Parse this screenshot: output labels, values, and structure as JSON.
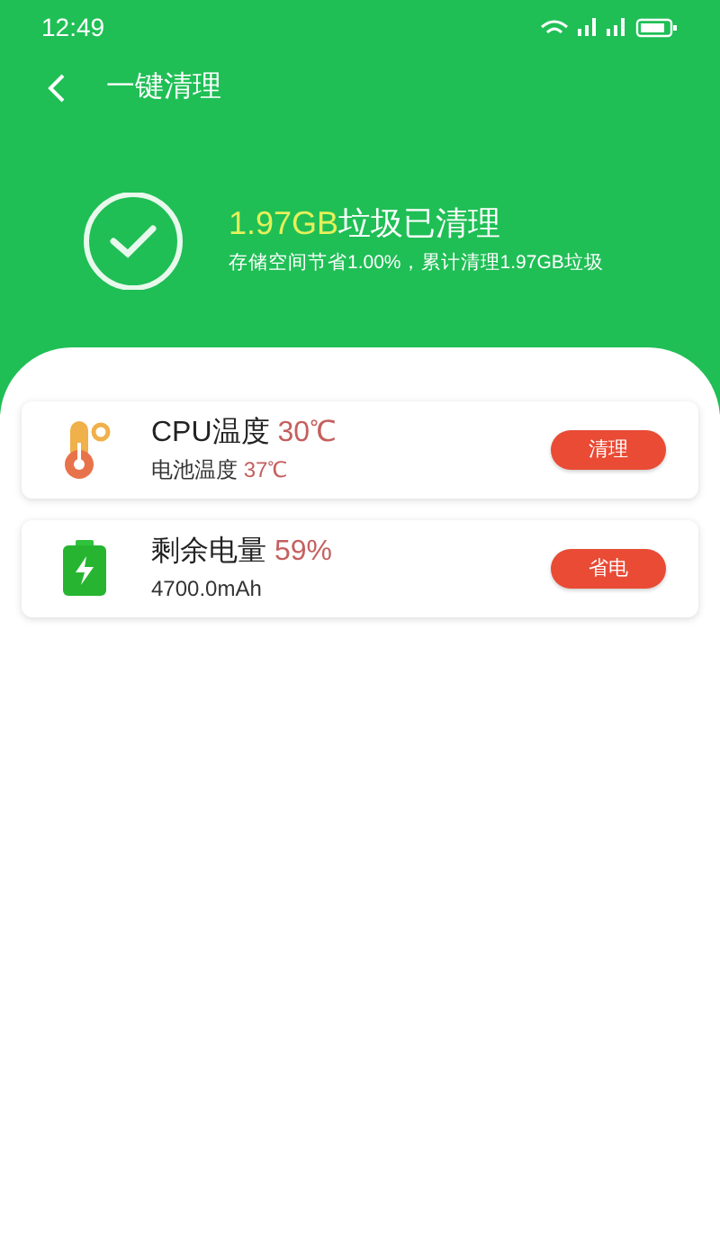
{
  "status_bar": {
    "time": "12:49"
  },
  "header": {
    "title": "一键清理"
  },
  "summary": {
    "amount": "1.97GB",
    "headline": "垃圾已清理",
    "detail": "存储空间节省1.00%，累计清理1.97GB垃圾"
  },
  "cards": [
    {
      "kind": "thermometer",
      "title": "CPU温度",
      "title_value": "30℃",
      "subtitle": "电池温度",
      "subtitle_value": "37℃",
      "button": "清理"
    },
    {
      "kind": "battery",
      "title": "剩余电量",
      "title_value": "59%",
      "subtitle": "4700.0mAh",
      "button": "省电"
    }
  ]
}
